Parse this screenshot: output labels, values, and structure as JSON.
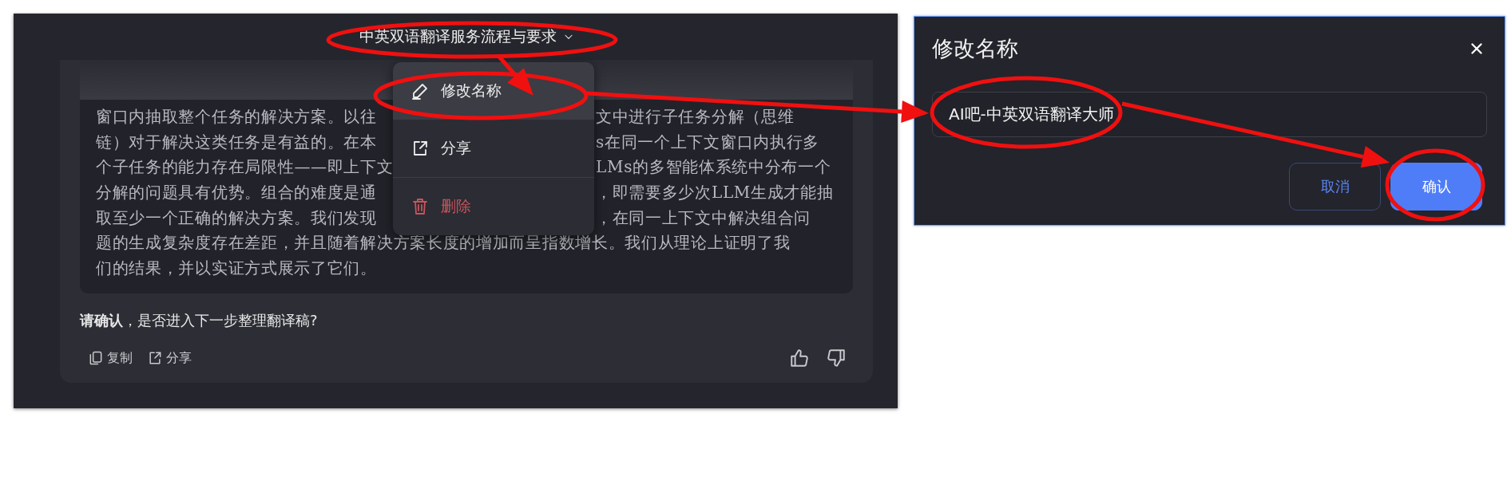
{
  "chat": {
    "title": "中英双语翻译服务流程与要求",
    "paragraph_lines": [
      {
        "left": "窗口内抽取整个任务的解决方案。以往",
        "right": "文中进行子任务分解（思维"
      },
      {
        "left": "链）对于解决这类任务是有益的。在本",
        "right": "s在同一个上下文窗口内执行多"
      },
      {
        "left": "个子任务的能力存在局限性——即上下文",
        "right": "LMs的多智能体系统中分布一个"
      },
      {
        "left": "分解的问题具有优势。组合的难度是通",
        "right": "，即需要多少次LLM生成才能抽"
      },
      {
        "left": "取至少一个正确的解决方案。我们发现",
        "right": "，在同一上下文中解决组合问"
      },
      {
        "left": "题的生成复杂度存在差距，并且随着解决方案长度的增加而呈指数增长。我们从理论上证明了我"
      },
      {
        "left": "们的结果，并以实证方式展示了它们。"
      }
    ],
    "prompt": "**请确认**，是否进入下一步整理翻译稿?",
    "actions": [
      {
        "kind": "copy",
        "label": "复制"
      },
      {
        "kind": "share",
        "label": "分享"
      }
    ],
    "feedback": [
      {
        "kind": "like"
      },
      {
        "kind": "dislike"
      }
    ],
    "menu": [
      {
        "kind": "edit",
        "label": "修改名称",
        "highlighted": true
      },
      {
        "kind": "share",
        "label": "分享",
        "highlighted": false
      },
      {
        "kind": "delete",
        "label": "删除",
        "highlighted": false
      }
    ]
  },
  "dialog": {
    "title": "修改名称",
    "value": "AI吧-中英双语翻译大师",
    "buttons": [
      {
        "kind": "secondary",
        "label": "取消"
      },
      {
        "kind": "primary",
        "label": "确认"
      }
    ]
  }
}
